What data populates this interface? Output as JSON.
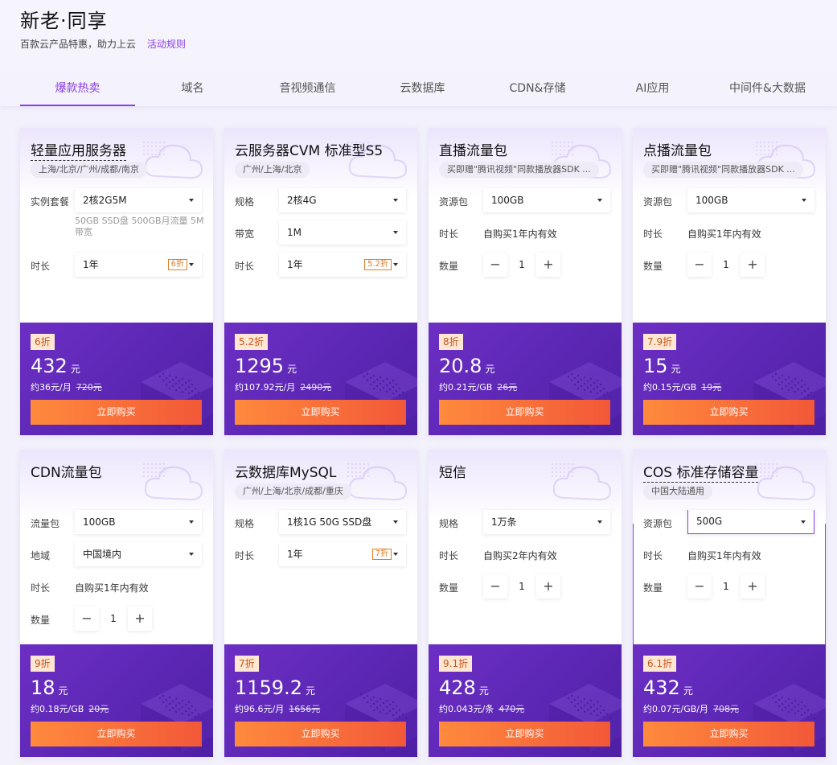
{
  "header": {
    "title": "新老·同享",
    "subtitle": "百款云产品特惠，助力上云",
    "rules_link": "活动规则"
  },
  "tabs": [
    {
      "label": "爆款热卖",
      "active": true
    },
    {
      "label": "域名"
    },
    {
      "label": "音视频通信"
    },
    {
      "label": "云数据库"
    },
    {
      "label": "CDN&存储"
    },
    {
      "label": "AI应用"
    },
    {
      "label": "中间件&大数据"
    }
  ],
  "colors": {
    "accent": "#8a3fe8",
    "buy_start": "#ff8a3c",
    "buy_end": "#f25838",
    "footer": "#6c2fc4"
  },
  "cards": [
    {
      "title": "轻量应用服务器",
      "region": "上海/北京/广州/成都/南京",
      "rows": [
        {
          "label": "实例套餐",
          "kind": "select",
          "value": "2核2G5M"
        },
        {
          "label": "",
          "kind": "note",
          "value": "50GB SSD盘 500GB月流量 5M带宽"
        },
        {
          "label": "时长",
          "kind": "select",
          "value": "1年",
          "tag": "6折"
        }
      ],
      "discount": "6折",
      "price": "432",
      "unit": "元",
      "per": "约36元/月",
      "original": "720元",
      "buy": "立即购买"
    },
    {
      "title": "云服务器CVM 标准型S5",
      "region": "广州/上海/北京",
      "rows": [
        {
          "label": "规格",
          "kind": "select",
          "value": "2核4G"
        },
        {
          "label": "带宽",
          "kind": "select",
          "value": "1M"
        },
        {
          "label": "时长",
          "kind": "select",
          "value": "1年",
          "tag": "5.2折"
        }
      ],
      "discount": "5.2折",
      "price": "1295",
      "unit": "元",
      "per": "约107.92元/月",
      "original": "2490元",
      "buy": "立即购买"
    },
    {
      "title": "直播流量包",
      "region": "买即赠\"腾讯视频\"同款播放器SDK ...",
      "rows": [
        {
          "label": "资源包",
          "kind": "select",
          "value": "100GB"
        },
        {
          "label": "时长",
          "kind": "text",
          "value": "自购买1年内有效"
        },
        {
          "label": "数量",
          "kind": "stepper",
          "value": "1"
        }
      ],
      "discount": "8折",
      "price": "20.8",
      "unit": "元",
      "per": "约0.21元/GB",
      "original": "26元",
      "buy": "立即购买"
    },
    {
      "title": "点播流量包",
      "region": "买即赠\"腾讯视频\"同款播放器SDK ...",
      "rows": [
        {
          "label": "资源包",
          "kind": "select",
          "value": "100GB"
        },
        {
          "label": "时长",
          "kind": "text",
          "value": "自购买1年内有效"
        },
        {
          "label": "数量",
          "kind": "stepper",
          "value": "1"
        }
      ],
      "discount": "7.9折",
      "price": "15",
      "unit": "元",
      "per": "约0.15元/GB",
      "original": "19元",
      "buy": "立即购买"
    },
    {
      "title": "CDN流量包",
      "region": "",
      "rows": [
        {
          "label": "流量包",
          "kind": "select",
          "value": "100GB"
        },
        {
          "label": "地域",
          "kind": "select",
          "value": "中国境内"
        },
        {
          "label": "时长",
          "kind": "text",
          "value": "自购买1年内有效"
        },
        {
          "label": "数量",
          "kind": "stepper",
          "value": "1"
        }
      ],
      "discount": "9折",
      "price": "18",
      "unit": "元",
      "per": "约0.18元/GB",
      "original": "20元",
      "buy": "立即购买"
    },
    {
      "title": "云数据库MySQL",
      "region": "广州/上海/北京/成都/重庆",
      "rows": [
        {
          "label": "规格",
          "kind": "select",
          "value": "1核1G 50G SSD盘"
        },
        {
          "label": "时长",
          "kind": "select",
          "value": "1年",
          "tag": "7折"
        }
      ],
      "discount": "7折",
      "price": "1159.2",
      "unit": "元",
      "per": "约96.6元/月",
      "original": "1656元",
      "buy": "立即购买"
    },
    {
      "title": "短信",
      "region": "",
      "rows": [
        {
          "label": "规格",
          "kind": "select",
          "value": "1万条"
        },
        {
          "label": "时长",
          "kind": "text",
          "value": "自购买2年内有效"
        },
        {
          "label": "数量",
          "kind": "stepper",
          "value": "1"
        }
      ],
      "discount": "9.1折",
      "price": "428",
      "unit": "元",
      "per": "约0.043元/条",
      "original": "470元",
      "buy": "立即购买"
    },
    {
      "title": "COS 标准存储容量",
      "region": "中国大陆通用",
      "rows": [
        {
          "label": "资源包",
          "kind": "select",
          "value": "500G",
          "focus": true
        },
        {
          "label": "时长",
          "kind": "text",
          "value": "自购买1年内有效"
        },
        {
          "label": "数量",
          "kind": "stepper",
          "value": "1"
        }
      ],
      "discount": "6.1折",
      "price": "432",
      "unit": "元",
      "per": "约0.07元/GB/月",
      "original": "708元",
      "buy": "立即购买"
    }
  ]
}
